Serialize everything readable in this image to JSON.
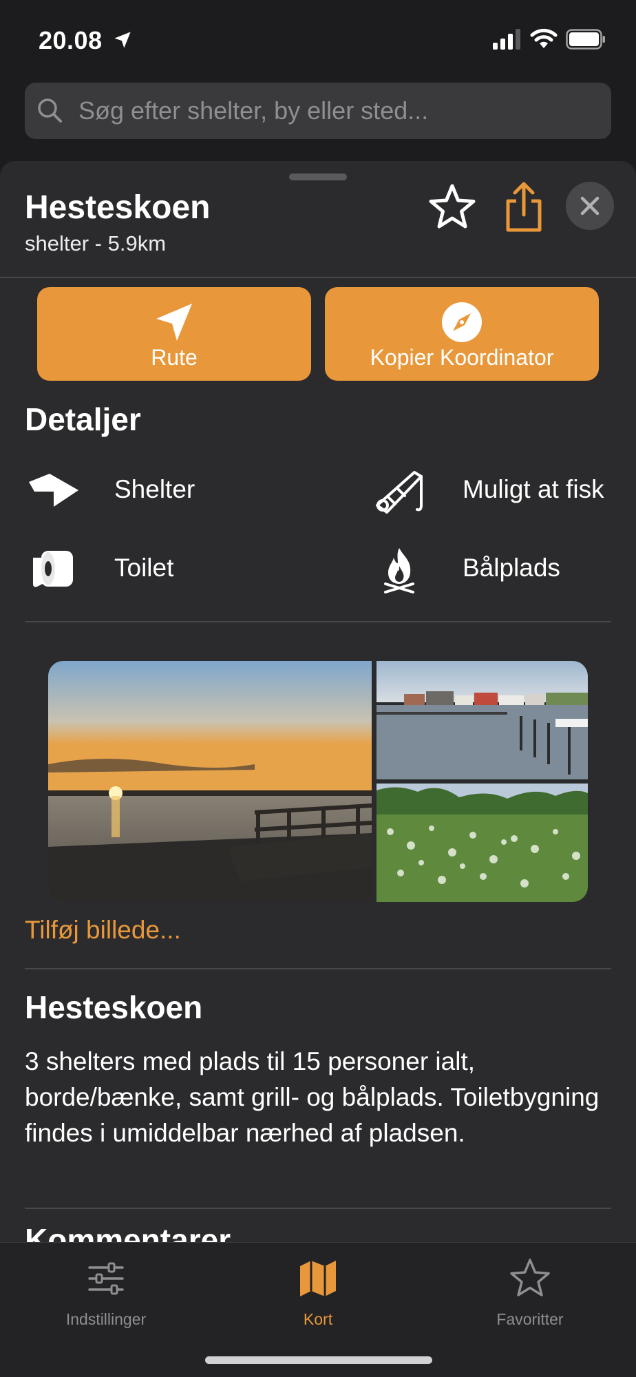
{
  "status": {
    "time": "20.08"
  },
  "search": {
    "placeholder": "Søg efter shelter, by eller sted..."
  },
  "sheet": {
    "title": "Hesteskoen",
    "subtitle": "shelter - 5.9km",
    "actions": [
      {
        "label": "Rute",
        "icon": "navigation-arrow-icon"
      },
      {
        "label": "Kopier Koordinator",
        "icon": "compass-icon"
      }
    ]
  },
  "details": {
    "heading": "Detaljer",
    "features": [
      {
        "label": "Shelter",
        "icon": "shelter-icon"
      },
      {
        "label": "Muligt at fisk",
        "icon": "fishing-rod-icon"
      },
      {
        "label": "Toilet",
        "icon": "toilet-paper-icon"
      },
      {
        "label": "Bålplads",
        "icon": "campfire-icon"
      }
    ]
  },
  "photos": {
    "add_label": "Tilføj billede..."
  },
  "description": {
    "heading": "Hesteskoen",
    "text": "3 shelters med plads til 15 personer ialt, borde/bænke, samt grill- og bålplads. Toiletbygning findes i umiddelbar nærhed af pladsen."
  },
  "comments": {
    "heading": "Kommentarer"
  },
  "tabs": [
    {
      "label": "Indstillinger",
      "icon": "sliders-icon",
      "active": false
    },
    {
      "label": "Kort",
      "icon": "map-icon",
      "active": true
    },
    {
      "label": "Favoritter",
      "icon": "star-icon",
      "active": false
    }
  ],
  "colors": {
    "accent": "#e8983a",
    "background": "#1c1c1e",
    "sheet": "#2b2b2d"
  }
}
